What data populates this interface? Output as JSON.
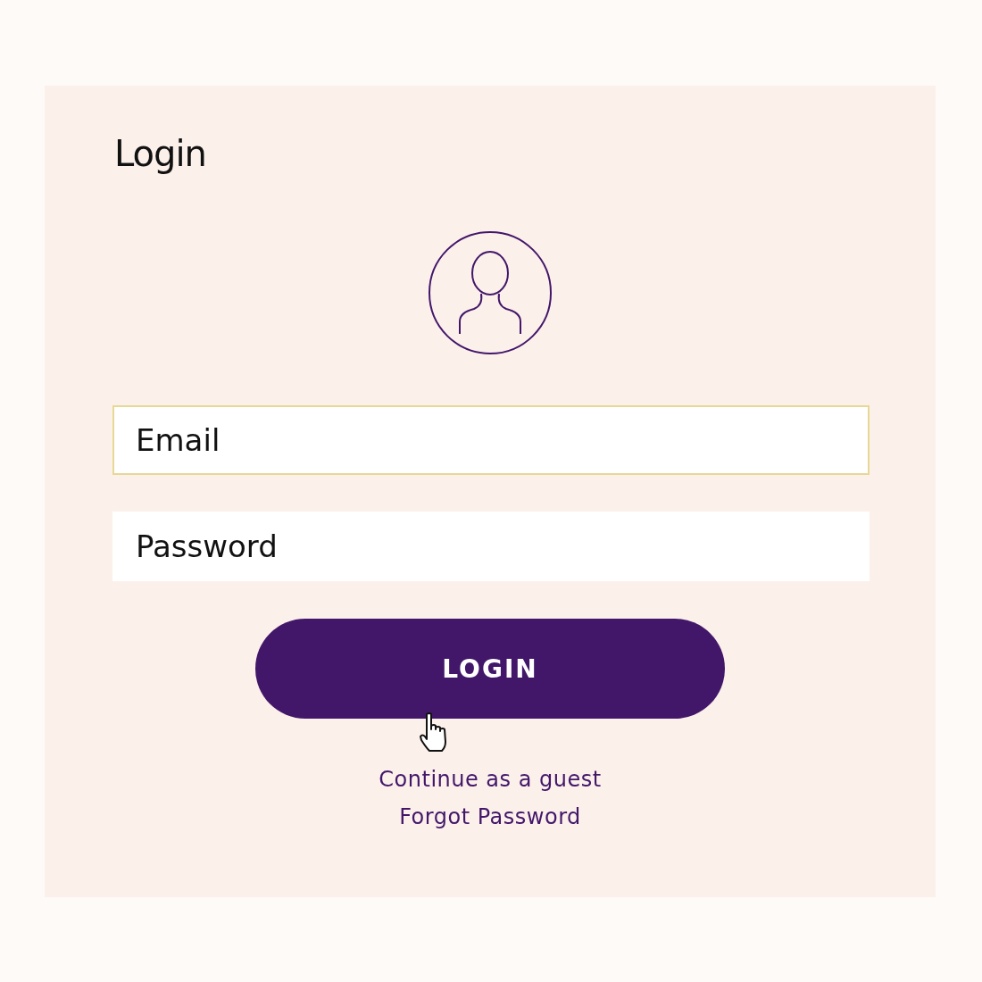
{
  "title": "Login",
  "fields": [
    {
      "placeholder": "Email",
      "focused": true
    },
    {
      "placeholder": "Password",
      "focused": false
    }
  ],
  "login_button": {
    "label": "LOGIN"
  },
  "links": [
    "Continue as a guest",
    "Forgot Password"
  ]
}
